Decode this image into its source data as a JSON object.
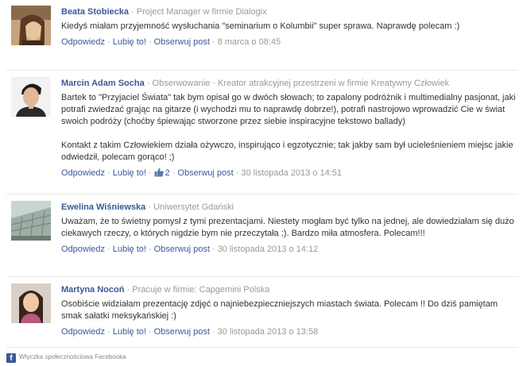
{
  "comments": [
    {
      "author": "Beata Stobiecka",
      "subtitle_prefix": "Project Manager w firmie ",
      "subtitle_link": "Dialogix",
      "paragraphs": [
        "Kiedyś miałam przyjemność wysłuchania \"seminarium o Kolumbii\" super sprawa. Naprawdę polecam :)"
      ],
      "actions": {
        "reply": "Odpowiedz",
        "like": "Lubię to!",
        "follow": "Obserwuj post"
      },
      "likes": "",
      "date": "8 marca o 08:45"
    },
    {
      "author": "Marcin Adam Socha",
      "subtitle_prefix": "Obserwowanie · Kreator atrakcyjnej przestrzeni w firmie ",
      "subtitle_link": "Kreatywny Człowiek",
      "paragraphs": [
        "Bartek to \"Przyjaciel Świata\" tak bym opisał go w dwóch słowach; to zapalony podróżnik i multimedialny pasjonat, jaki potrafi zwiedzać grając na gitarze (i wychodzi mu to naprawdę dobrze!), potrafi nastrojowo wprowadzić Cie w świat swoich podróży (choćby śpiewając stworzone przez siebie inspiracyjne tekstowo ballady)",
        "Kontakt z takim Człowiekiem działa ożywczo, inspirująco i egzotycznie; tak jakby sam był ucieleśnieniem miejsc jakie odwiedził, polecam gorąco! ;)"
      ],
      "actions": {
        "reply": "Odpowiedz",
        "like": "Lubię to!",
        "follow": "Obserwuj post"
      },
      "likes": "2",
      "date": "30 listopada 2013 o 14:51"
    },
    {
      "author": "Ewelina Wiśniewska",
      "subtitle_prefix": "Uniwersytet Gdański",
      "subtitle_link": "",
      "paragraphs": [
        "Uważam, że to świetny pomysł z tymi prezentacjami. Niestety mogłam być tylko na jednej, ale dowiedziałam się dużo ciekawych rzeczy, o których nigdzie bym nie przeczytała ;). Bardzo miła atmosfera. Polecam!!!"
      ],
      "actions": {
        "reply": "Odpowiedz",
        "like": "Lubię to!",
        "follow": "Obserwuj post"
      },
      "likes": "",
      "date": "30 listopada 2013 o 14:12"
    },
    {
      "author": "Martyna Nocoń",
      "subtitle_prefix": "Pracuje w firmie: ",
      "subtitle_link": "Capgemini Polska",
      "paragraphs": [
        "Osobiście widziałam prezentację zdjęć o najniebezpieczniejszych miastach świata. Polecam !! Do dziś pamiętam smak sałatki meksykańskiej :)"
      ],
      "actions": {
        "reply": "Odpowiedz",
        "like": "Lubię to!",
        "follow": "Obserwuj post"
      },
      "likes": "",
      "date": "30 listopada 2013 o 13:58"
    }
  ],
  "footer": {
    "icon": "facebook-icon",
    "text": "Wtyczka społecznościowa Facebooka"
  },
  "colors": {
    "link": "#3b5998",
    "meta": "#999999",
    "text": "#333333",
    "divider": "#e9e9e9"
  }
}
